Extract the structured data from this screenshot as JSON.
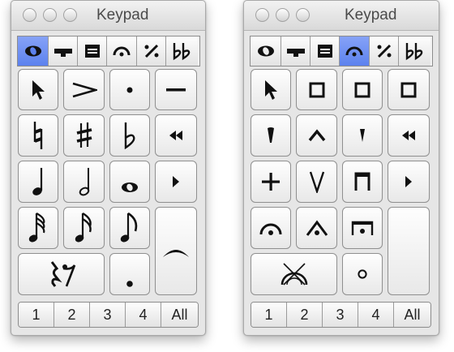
{
  "left_window": {
    "title": "Keypad",
    "tabs": [
      {
        "icon": "whole-note-tab-icon",
        "active": true
      },
      {
        "icon": "articulation-tab-icon",
        "active": false
      },
      {
        "icon": "barline-tab-icon",
        "active": false
      },
      {
        "icon": "fermata-tab-icon",
        "active": false
      },
      {
        "icon": "repeat-tab-icon",
        "active": false
      },
      {
        "icon": "double-flat-tab-icon",
        "active": false
      }
    ],
    "keys": [
      {
        "icon": "arrow-pointer-icon"
      },
      {
        "icon": "accent-icon"
      },
      {
        "icon": "staccato-dot-icon"
      },
      {
        "icon": "tenuto-icon"
      },
      {
        "icon": "natural-icon"
      },
      {
        "icon": "sharp-icon"
      },
      {
        "icon": "flat-icon"
      },
      {
        "icon": "rewind-icon"
      },
      {
        "icon": "quarter-note-icon"
      },
      {
        "icon": "half-note-icon"
      },
      {
        "icon": "whole-note-icon"
      },
      {
        "icon": "play-icon"
      },
      {
        "icon": "thirty-second-note-icon"
      },
      {
        "icon": "sixteenth-note-icon"
      },
      {
        "icon": "eighth-note-icon"
      },
      {
        "icon": "tie-icon"
      },
      {
        "icon": "rest-icon"
      },
      {
        "icon": "dot-icon"
      }
    ],
    "numbers": [
      "1",
      "2",
      "3",
      "4",
      "All"
    ]
  },
  "right_window": {
    "title": "Keypad",
    "tabs": [
      {
        "icon": "whole-note-tab-icon",
        "active": false
      },
      {
        "icon": "articulation-tab-icon",
        "active": false
      },
      {
        "icon": "barline-tab-icon",
        "active": false
      },
      {
        "icon": "fermata-tab-icon",
        "active": true
      },
      {
        "icon": "repeat-tab-icon",
        "active": false
      },
      {
        "icon": "double-flat-tab-icon",
        "active": false
      }
    ],
    "keys": [
      {
        "icon": "arrow-pointer-icon"
      },
      {
        "icon": "square-icon"
      },
      {
        "icon": "square-icon"
      },
      {
        "icon": "square-icon"
      },
      {
        "icon": "staccatissimo-icon"
      },
      {
        "icon": "marcato-up-icon"
      },
      {
        "icon": "staccatissimo-down-icon"
      },
      {
        "icon": "rewind-icon"
      },
      {
        "icon": "plus-icon"
      },
      {
        "icon": "up-bow-icon"
      },
      {
        "icon": "down-bow-icon"
      },
      {
        "icon": "play-icon"
      },
      {
        "icon": "fermata-icon"
      },
      {
        "icon": "marcato-fermata-icon"
      },
      {
        "icon": "square-fermata-icon"
      },
      {
        "icon": "blank-key"
      },
      {
        "icon": "stopped-x-icon"
      },
      {
        "icon": "harmonic-circle-icon"
      }
    ],
    "numbers": [
      "1",
      "2",
      "3",
      "4",
      "All"
    ]
  },
  "colors": {
    "window_bg": "#e6e6e6",
    "active_tab": "#5c82ee",
    "key_border": "#8f8f8f"
  }
}
